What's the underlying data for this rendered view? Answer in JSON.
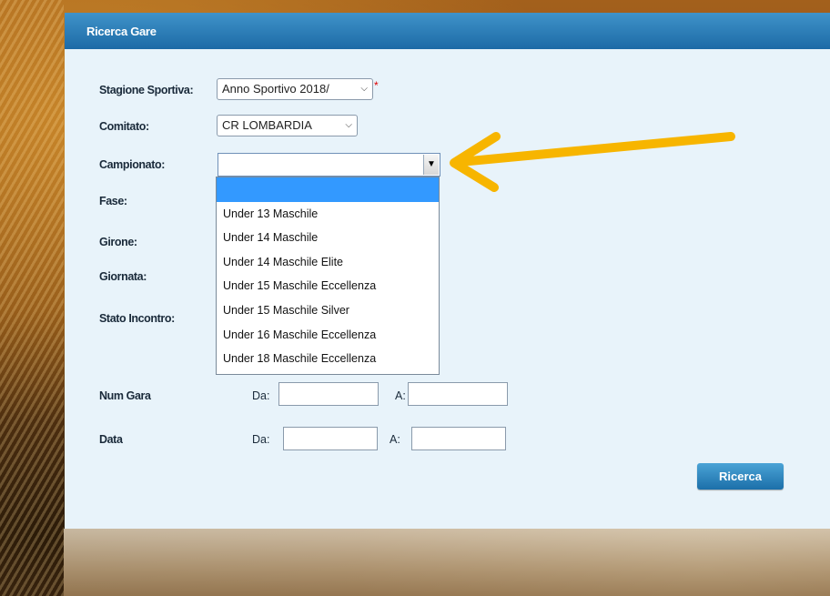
{
  "panel": {
    "title": "Ricerca Gare"
  },
  "fields": {
    "stagione": {
      "label": "Stagione Sportiva:",
      "value": "Anno Sportivo 2018/",
      "required_mark": "*"
    },
    "comitato": {
      "label": "Comitato:",
      "value": "CR LOMBARDIA"
    },
    "campionato": {
      "label": "Campionato:",
      "value": ""
    },
    "fase": {
      "label": "Fase:"
    },
    "girone": {
      "label": "Girone:"
    },
    "giornata": {
      "label": "Giornata:"
    },
    "stato_incontro": {
      "label": "Stato Incontro:"
    },
    "num_gara": {
      "label": "Num Gara",
      "da_label": "Da:",
      "a_label": "A:",
      "da_value": "",
      "a_value": ""
    },
    "data": {
      "label": "Data",
      "da_label": "Da:",
      "a_label": "A:",
      "da_value": "",
      "a_value": ""
    }
  },
  "campionato_options": [
    "",
    "Under 13 Maschile",
    "Under 14 Maschile",
    "Under 14 Maschile Elite",
    "Under 15 Maschile Eccellenza",
    "Under 15 Maschile Silver",
    "Under 16 Maschile Eccellenza",
    "Under 18 Maschile Eccellenza"
  ],
  "selected_option_index": 0,
  "search_button": {
    "label": "Ricerca"
  },
  "colors": {
    "header": "#1d6aa6",
    "panel_bg": "#e8f3fa",
    "selected_option": "#3399ff",
    "annotation_arrow": "#f7b500",
    "required": "#dd0000"
  },
  "icons": {
    "dropdown": "chevron-down-icon",
    "annotation": "arrow-pointer-icon"
  }
}
